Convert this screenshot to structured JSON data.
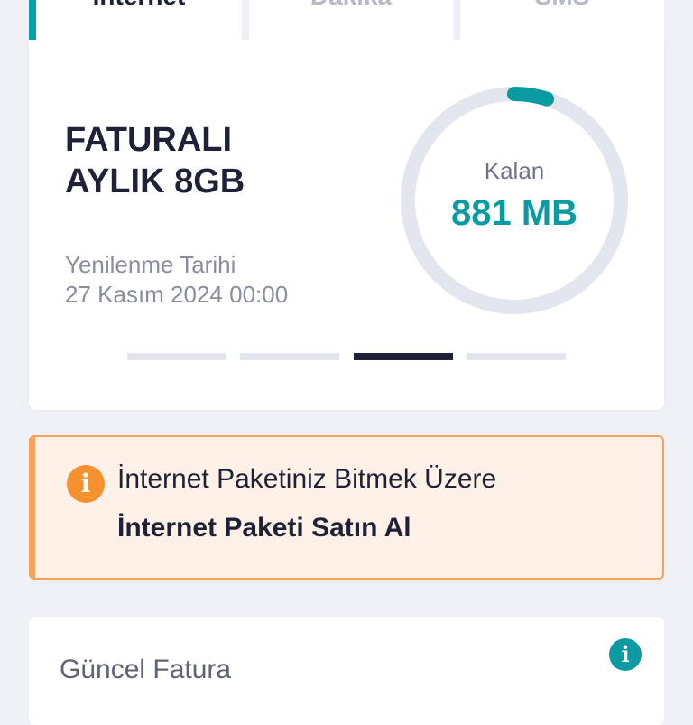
{
  "tabs": [
    {
      "label": "İnternet",
      "active": true
    },
    {
      "label": "Dakika",
      "active": false
    },
    {
      "label": "SMS",
      "active": false
    }
  ],
  "package": {
    "name_line1": "FATURALI",
    "name_line2": "AYLIK 8GB",
    "renewal_label": "Yenilenme Tarihi",
    "renewal_date": "27 Kasım 2024 00:00",
    "remaining_label": "Kalan",
    "remaining_value": "881 MB",
    "remaining_fraction": 0.11,
    "ring_color": "#0a9aa1",
    "track_color": "#e3e6ee"
  },
  "pager": {
    "count": 4,
    "active_index": 2
  },
  "alert": {
    "icon": "info-icon",
    "title": "İnternet Paketiniz Bitmek Üzere",
    "link": "İnternet Paketi Satın Al",
    "accent_color": "#f5912f"
  },
  "bill": {
    "title": "Güncel Fatura",
    "icon": "info-icon"
  }
}
